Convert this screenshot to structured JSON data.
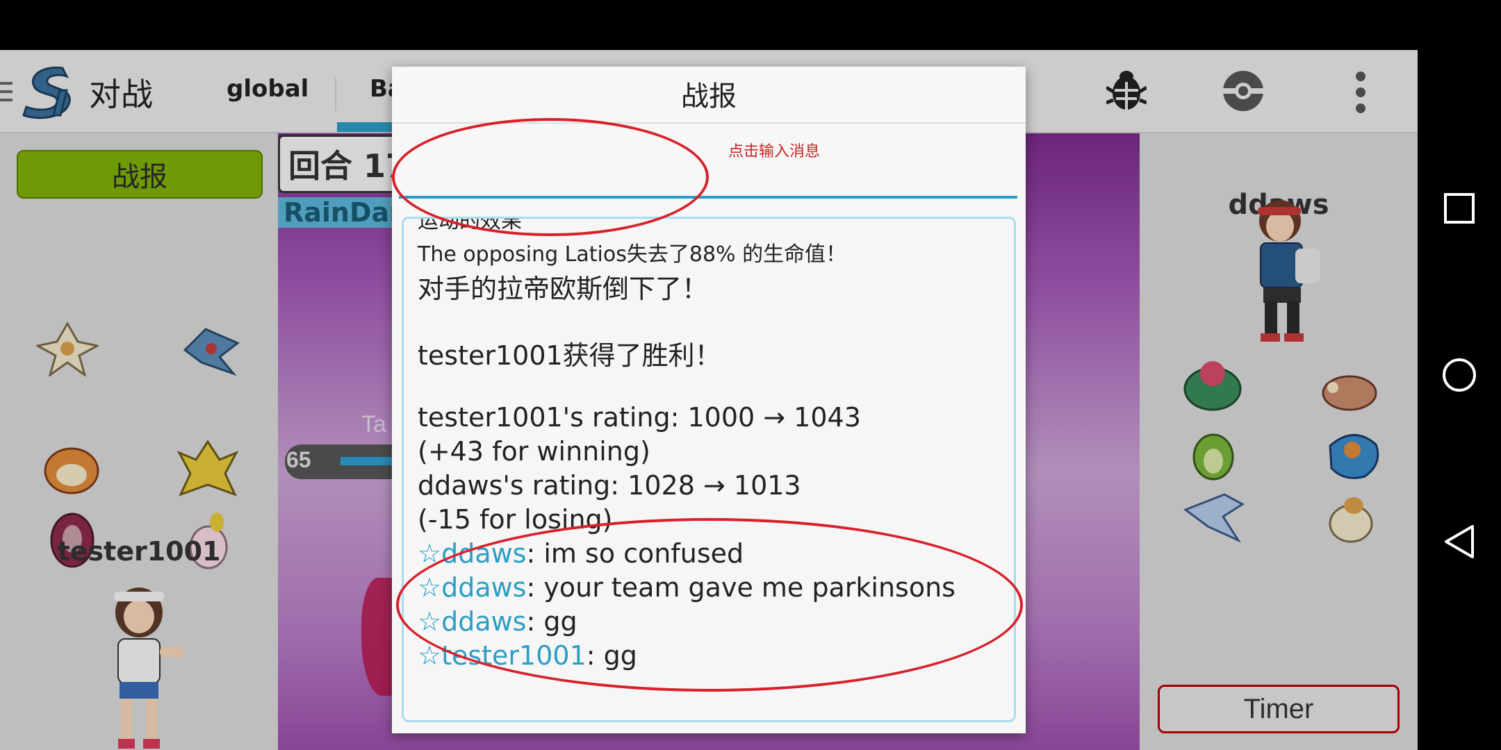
{
  "app": {
    "title": "对战",
    "tabs": [
      {
        "label": "global"
      },
      {
        "label": "Ba"
      }
    ]
  },
  "left_panel": {
    "report_button": "战报",
    "player_name": "tester1001"
  },
  "battle": {
    "turn_label": "回合 17",
    "weather_label": "RainDan",
    "faded_label": "Ta",
    "hp_value": "65"
  },
  "right_panel": {
    "player_name": "ddaws",
    "timer_button": "Timer"
  },
  "dialog": {
    "title": "战报",
    "input_placeholder": "",
    "input_hint": "点击输入消息",
    "log": {
      "partial_top": "运动的效果",
      "lines": [
        "The opposing Latios失去了88% 的生命值！",
        "对手的拉帝欧斯倒下了！",
        "tester1001获得了胜利！",
        "tester1001's rating: 1000 → 1043",
        "(+43 for winning)",
        "ddaws's rating: 1028 → 1013",
        "(-15 for losing)"
      ],
      "chat": [
        {
          "star": "☆",
          "name": "ddaws",
          "message": ": im so confused"
        },
        {
          "star": "☆",
          "name": "ddaws",
          "message": ": your team gave me parkinsons"
        },
        {
          "star": "☆",
          "name": "ddaws",
          "message": ": gg"
        },
        {
          "star": "☆",
          "name": "tester1001",
          "message": ": gg"
        }
      ]
    }
  },
  "colors": {
    "accent": "#2a9ec4",
    "report_button": "#7eb006",
    "annotation": "#d8202b"
  },
  "icons": [
    "menu-icon",
    "showdown-logo-icon",
    "bug-icon",
    "pokeball-icon",
    "overflow-menu-icon",
    "recent-apps-icon",
    "home-icon",
    "back-icon"
  ]
}
